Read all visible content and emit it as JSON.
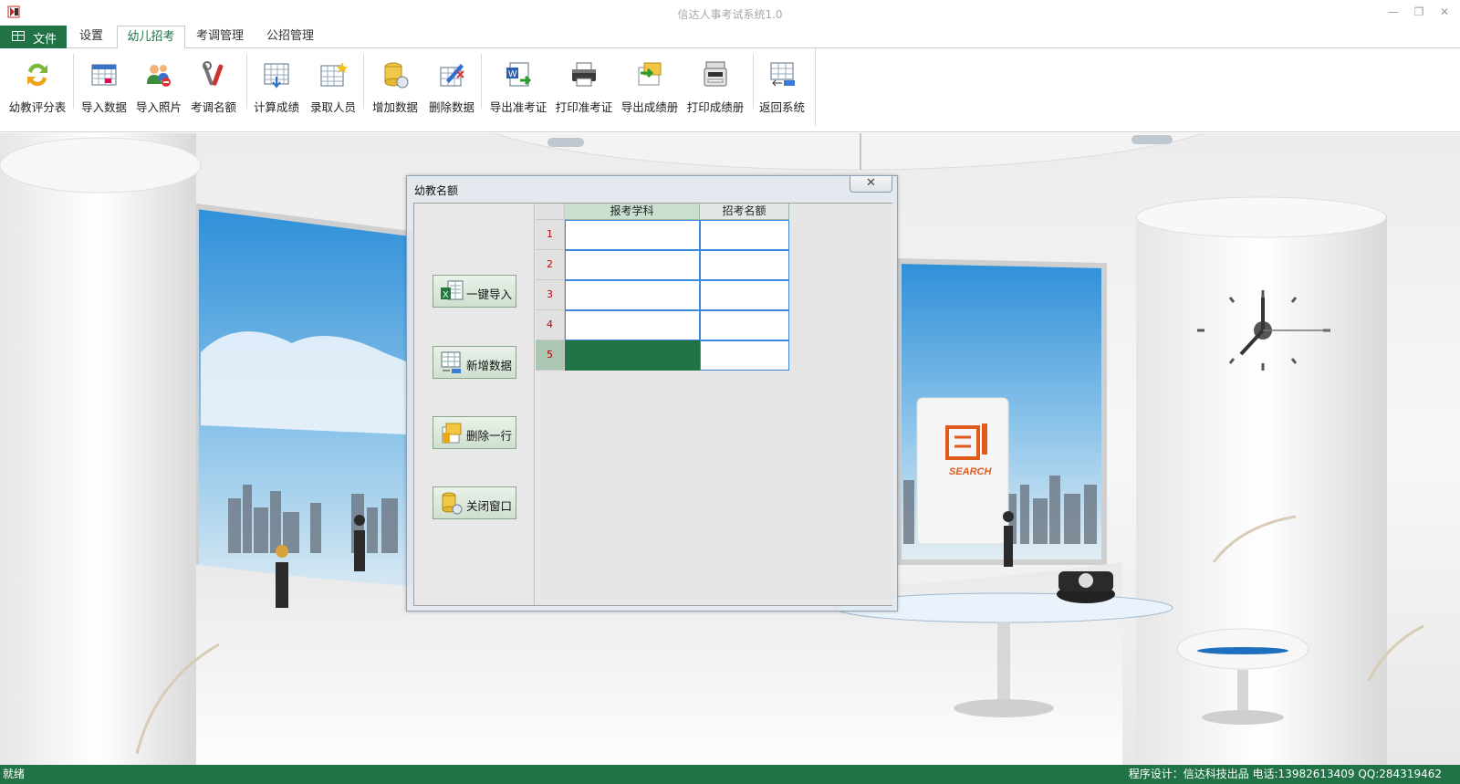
{
  "window": {
    "title": "信达人事考试系统1.0",
    "minimize_glyph": "—",
    "restore_glyph": "❐",
    "close_glyph": "✕"
  },
  "tabs": {
    "file_label": "文件",
    "items": [
      "设置",
      "幼儿招考",
      "考调管理",
      "公招管理"
    ],
    "active": "幼儿招考"
  },
  "ribbon": {
    "buttons": [
      {
        "label": "幼教评分表",
        "icon": "refresh-icon"
      },
      {
        "label": "导入数据",
        "icon": "calendar-import-icon"
      },
      {
        "label": "导入照片",
        "icon": "users-photo-icon"
      },
      {
        "label": "考调名额",
        "icon": "tools-icon"
      },
      {
        "label": "计算成绩",
        "icon": "table-download-icon"
      },
      {
        "label": "录取人员",
        "icon": "table-star-icon"
      },
      {
        "label": "增加数据",
        "icon": "database-add-icon"
      },
      {
        "label": "删除数据",
        "icon": "edit-delete-icon"
      },
      {
        "label": "导出准考证",
        "icon": "word-export-icon"
      },
      {
        "label": "打印准考证",
        "icon": "printer-icon"
      },
      {
        "label": "导出成绩册",
        "icon": "folder-export-icon"
      },
      {
        "label": "打印成绩册",
        "icon": "copier-icon"
      },
      {
        "label": "返回系统",
        "icon": "table-return-icon"
      }
    ]
  },
  "dialog": {
    "title": "幼教名额",
    "close_glyph": "✕",
    "buttons": [
      {
        "label": "一键导入",
        "icon": "excel-import-icon"
      },
      {
        "label": "新增数据",
        "icon": "table-add-icon"
      },
      {
        "label": "删除一行",
        "icon": "folder-delete-icon"
      },
      {
        "label": "关闭窗口",
        "icon": "database-close-icon"
      }
    ],
    "grid": {
      "columns": [
        "报考学科",
        "招考名额"
      ],
      "rows": [
        {
          "num": "1",
          "subject": "",
          "quota": ""
        },
        {
          "num": "2",
          "subject": "",
          "quota": ""
        },
        {
          "num": "3",
          "subject": "",
          "quota": ""
        },
        {
          "num": "4",
          "subject": "",
          "quota": ""
        },
        {
          "num": "5",
          "subject": "",
          "quota": ""
        }
      ],
      "selected_row": 5
    }
  },
  "scene": {
    "search_sign": "SEARCH"
  },
  "status": {
    "left": "就绪",
    "right": "程序设计：信达科技出品 电话:13982613409 QQ:284319462"
  },
  "colors": {
    "accent": "#217346",
    "sky": "#4aa3e0",
    "selection_border": "#3b8ad9"
  }
}
